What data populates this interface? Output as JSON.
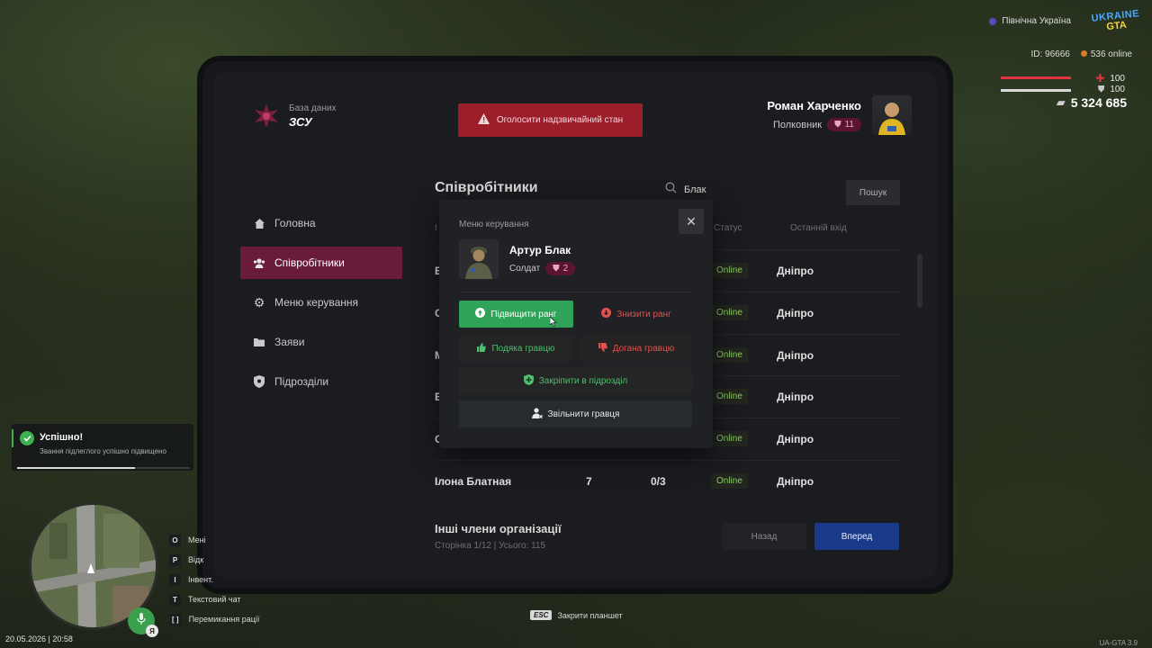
{
  "hud": {
    "region": "Північна Україна",
    "logo_line1": "UKRAINE",
    "logo_line2": "GTA",
    "player_id": "ID: 96666",
    "online": "536 online",
    "health": "100",
    "health_fraction": 1.0,
    "armor": "100",
    "armor_fraction": 1.0,
    "money": "5 324 685",
    "colors": {
      "health": "#e0323f",
      "armor": "#d8d8d8",
      "online_dot": "#e07a22"
    }
  },
  "header": {
    "brand_sub": "База даних",
    "brand_title": "ЗСУ",
    "emergency_label": "Оголосити надзвичайний стан",
    "profile_name": "Роман Харченко",
    "profile_rank": "Полковник",
    "profile_rank_level": "11"
  },
  "sidebar": {
    "items": [
      {
        "label": "Головна",
        "icon": "home-icon",
        "active": false
      },
      {
        "label": "Співробітники",
        "icon": "users-icon",
        "active": true
      },
      {
        "label": "Меню керування",
        "icon": "gear-icon",
        "active": false
      },
      {
        "label": "Заяви",
        "icon": "folder-icon",
        "active": false
      },
      {
        "label": "Підрозділи",
        "icon": "shield-icon",
        "active": false
      }
    ]
  },
  "main": {
    "title": "Співробітники",
    "search_value": "Блак",
    "search_button": "Пошук",
    "columns": {
      "first": "І",
      "status": "Статус",
      "last_login": "Останній вхід"
    },
    "rows": [
      {
        "name": "Б",
        "num1": "",
        "num2": "",
        "status": "Online",
        "city": "Дніпро"
      },
      {
        "name": "С",
        "num1": "",
        "num2": "",
        "status": "Online",
        "city": "Дніпро"
      },
      {
        "name": "М",
        "num1": "",
        "num2": "",
        "status": "Online",
        "city": "Дніпро"
      },
      {
        "name": "Б",
        "num1": "",
        "num2": "",
        "status": "Online",
        "city": "Дніпро"
      },
      {
        "name": "С",
        "num1": "",
        "num2": "",
        "status": "Online",
        "city": "Дніпро"
      },
      {
        "name": "Ілона Блатная",
        "num1": "7",
        "num2": "0/3",
        "status": "Online",
        "city": "Дніпро"
      }
    ],
    "footer_title": "Інші члени організації",
    "footer_sub": "Сторінка 1/12 | Усього: 115",
    "back_label": "Назад",
    "next_label": "Вперед"
  },
  "modal": {
    "title": "Меню керування",
    "user_name": "Артур Блак",
    "user_rank": "Солдат",
    "user_rank_level": "2",
    "promote": "Підвищити ранг",
    "demote": "Знизити ранг",
    "thanks": "Подяка гравцю",
    "reprimand": "Догана гравцю",
    "assign": "Закріпити в підрозділ",
    "fire": "Звільнити гравця",
    "close": "✕"
  },
  "notification": {
    "title": "Успішно!",
    "text": "Звання підлеглого успішно підвищено",
    "progress_fraction": 0.68
  },
  "hotkeys": [
    {
      "key": "O",
      "label": "Мені"
    },
    {
      "key": "P",
      "label": "Відк"
    },
    {
      "key": "I",
      "label": "Інвент."
    },
    {
      "key": "T",
      "label": "Текстовий чат"
    },
    {
      "key": "[   ]",
      "label": "Перемикання рації"
    }
  ],
  "mic_lang": "Я",
  "datetime": "20.05.2026 | 20:58",
  "esc": {
    "key": "ESC",
    "label": "Закрити планшет"
  },
  "version": "UA-GTA 3.9"
}
